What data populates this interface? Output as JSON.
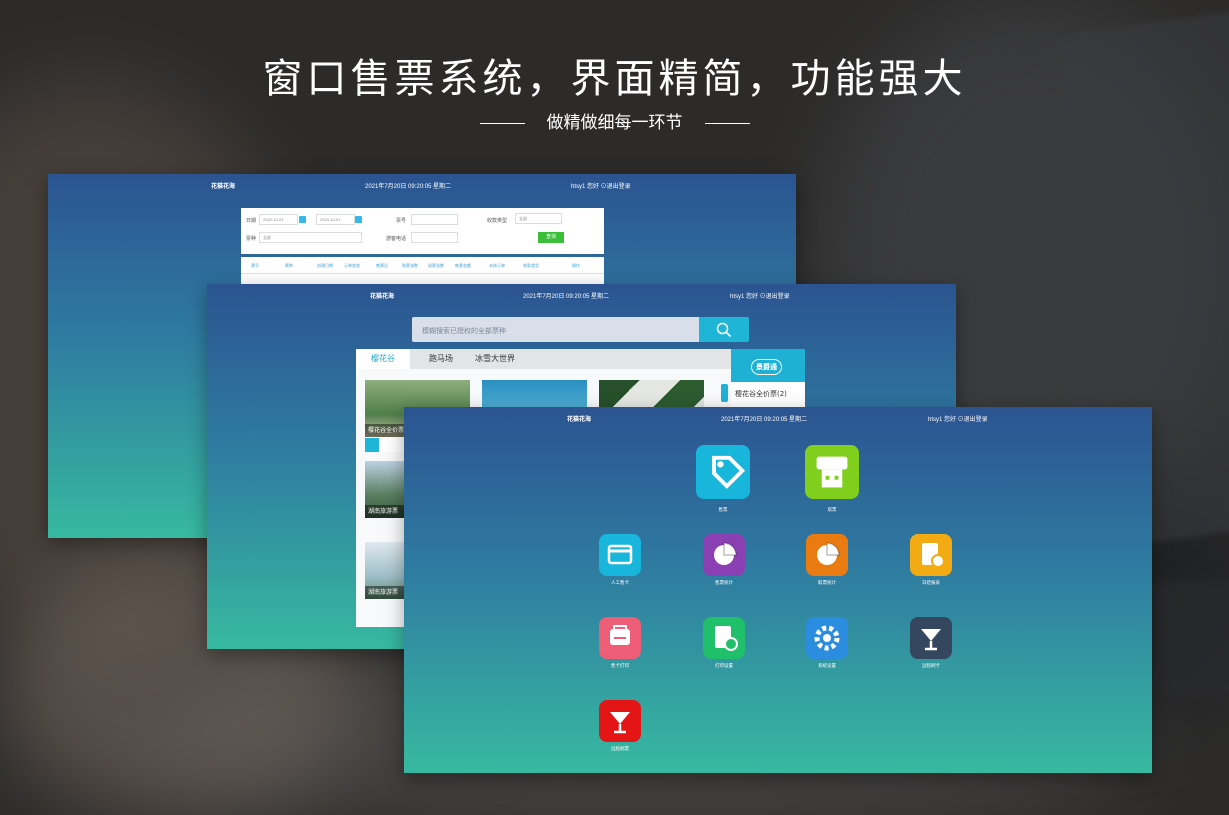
{
  "hero": {
    "title": "窗口售票系统，界面精简，功能强大",
    "subtitle": "做精做细每一环节"
  },
  "window_back": {
    "app_name": "花猫花海",
    "datetime": "2021年7月20日 09:20:05 星期二",
    "user": "htsy1 您好 ⊙退出登录",
    "filters": {
      "date_label": "日期",
      "date_from": "2020-10-01",
      "date_to": "2020-10-01",
      "order_no_label": "票号",
      "pay_type_label": "收款类型",
      "pay_type_value": "全部",
      "ticket_type_label": "票种",
      "ticket_type_value": "全部",
      "phone_label": "游客电话",
      "query_button": "查询"
    },
    "table_headers": [
      "票号",
      "票种",
      "创建日期",
      "订单状态",
      "售票员",
      "购票张数",
      "退票张数",
      "售票金额",
      "未核订单",
      "收款类型",
      "操作"
    ]
  },
  "window_middle": {
    "app_name": "花猫花海",
    "datetime": "2021年7月20日 09:20:05 星期二",
    "user": "htsy1 您好 ⊙退出登录",
    "search_placeholder": "模糊搜索已授权的全部票种",
    "tabs": [
      "樱花谷",
      "跑马场",
      "冰雪大世界"
    ],
    "cards": [
      "樱花谷全价票",
      "湖南旅游票",
      "湖南旅游票"
    ],
    "side_logo": "景爵通",
    "side_item": "樱花谷全价票(2)"
  },
  "window_front": {
    "app_name": "花猫花海",
    "datetime": "2021年7月20日 09:20:05 星期二",
    "user": "htsy1 您好 ⊙退出登录",
    "apps": [
      {
        "label": "售票",
        "icon": "tag-icon",
        "color": "#17b6da"
      },
      {
        "label": "取票",
        "icon": "ticket-machine-icon",
        "color": "#7fcf1c"
      },
      {
        "label": "人工售卡",
        "icon": "card-icon",
        "color": "#17b6da"
      },
      {
        "label": "售票统计",
        "icon": "pie-chart-icon",
        "color": "#8a3fb3"
      },
      {
        "label": "取票统计",
        "icon": "pie-chart-icon",
        "color": "#e97b10"
      },
      {
        "label": "日结报表",
        "icon": "report-icon",
        "color": "#f2ab13"
      },
      {
        "label": "售卡打印",
        "icon": "printer-icon",
        "color": "#ee5e77"
      },
      {
        "label": "打印设置",
        "icon": "settings-doc-icon",
        "color": "#20c06a"
      },
      {
        "label": "系统设置",
        "icon": "gear-icon",
        "color": "#2b8de0"
      },
      {
        "label": "远程刷卡",
        "icon": "cup-icon",
        "color": "#34475e"
      },
      {
        "label": "远程刷票",
        "icon": "cup-icon",
        "color": "#e31515"
      }
    ]
  }
}
